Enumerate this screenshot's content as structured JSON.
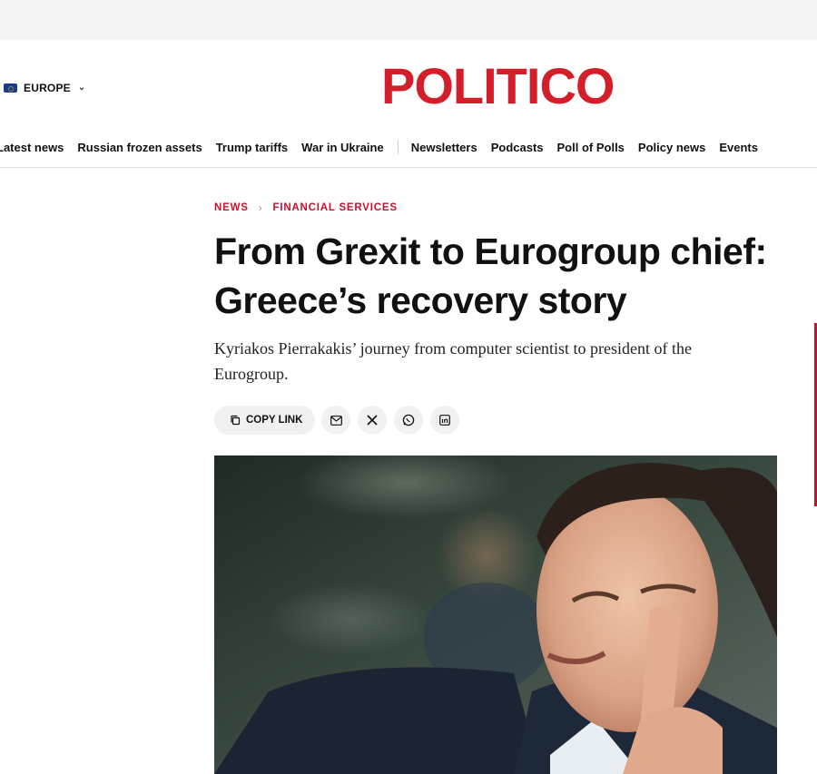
{
  "region": {
    "label": "EUROPE"
  },
  "logo": {
    "text": "POLITICO"
  },
  "nav": {
    "primary": [
      "Latest news",
      "Russian frozen assets",
      "Trump tariffs",
      "War in Ukraine"
    ],
    "secondary": [
      "Newsletters",
      "Podcasts",
      "Poll of Polls",
      "Policy news",
      "Events"
    ]
  },
  "breadcrumb": {
    "section": "NEWS",
    "subsection": "FINANCIAL SERVICES"
  },
  "article": {
    "headline": "From Grexit to Eurogroup chief: Greece’s recovery story",
    "dek": "Kyriakos Pierrakakis’ journey from computer scientist to president of the Eurogroup."
  },
  "share": {
    "copy_label": "COPY LINK",
    "icons": [
      "mail-icon",
      "x-icon",
      "whatsapp-icon",
      "linkedin-icon"
    ]
  },
  "colors": {
    "brand": "#d31f2a",
    "kicker": "#c8102e"
  }
}
